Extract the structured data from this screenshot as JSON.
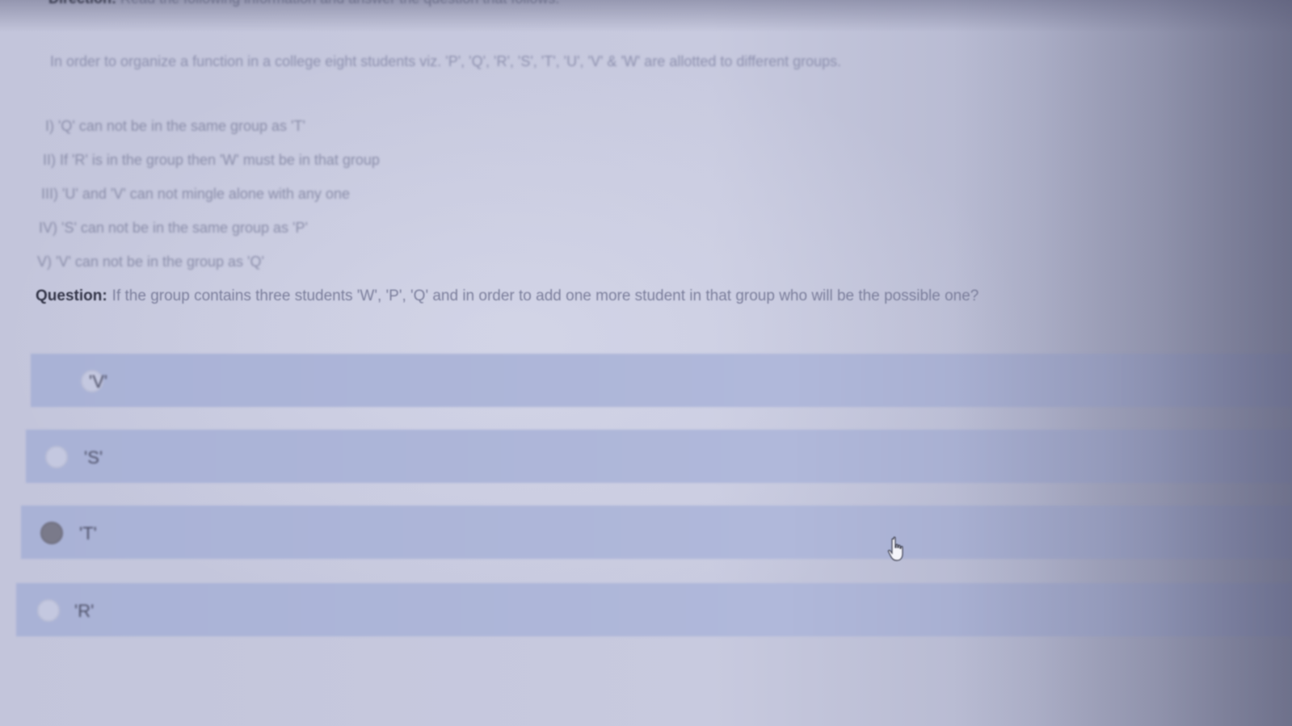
{
  "header": {
    "label": "Direction:",
    "text": "Read the following information and answer the question that follows."
  },
  "passage": {
    "intro": "In order to organize a function in a college eight students viz. 'P', 'Q', 'R', 'S', 'T', 'U', 'V' & 'W' are allotted to different groups.",
    "conditions": [
      "I) 'Q' can not be in the same group as 'T'",
      "II) If 'R' is in the group then 'W' must be in that group",
      "III) 'U' and 'V' can not mingle alone with any one",
      "IV) 'S' can not be in the same group as 'P'",
      "V) 'V' can not be in the group as 'Q'"
    ]
  },
  "question": {
    "label": "Question:",
    "text": "If the group contains three students 'W', 'P', 'Q' and in order to add one more student in that group who will be the possible one?"
  },
  "options": [
    {
      "label": "'V'",
      "selected": false
    },
    {
      "label": "'S'",
      "selected": false
    },
    {
      "label": "'T'",
      "selected": true
    },
    {
      "label": "'R'",
      "selected": false
    }
  ],
  "icons": {
    "cursor": "hand-pointer-icon"
  },
  "colors": {
    "option_background": "#aeb6d8",
    "selected_radio": "#7a7a8a",
    "question_label": "#35374a"
  }
}
